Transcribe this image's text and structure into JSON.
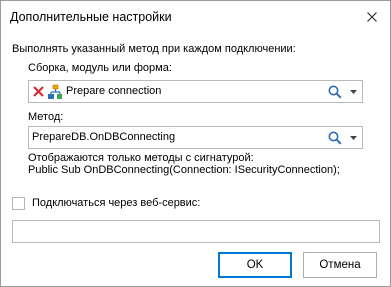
{
  "dialog": {
    "title": "Дополнительные настройки"
  },
  "main": {
    "run_method_label": "Выполнять указанный метод при каждом подключении:",
    "assembly_label": "Сборка, модуль или форма:",
    "assembly_value": "Prepare connection",
    "method_label": "Метод:",
    "method_value": "PrepareDB.OnDBConnecting",
    "signature_hint_line1": "Отображаются только методы с сигнатурой:",
    "signature_hint_line2": "Public Sub OnDBConnecting(Connection: ISecurityConnection);",
    "webservice_checkbox_label": "Подключаться через веб-сервис:",
    "webservice_checked": false,
    "webservice_url_value": ""
  },
  "footer": {
    "ok_label": "OK",
    "cancel_label": "Отмена"
  },
  "icons": {
    "close": "close-icon",
    "clear": "clear-x-icon",
    "assembly": "assembly-icon",
    "search": "search-icon",
    "dropdown": "chevron-down-icon"
  },
  "colors": {
    "clear_x": "#d9262b",
    "search": "#2f6db5",
    "default_button_border": "#0078d7"
  }
}
